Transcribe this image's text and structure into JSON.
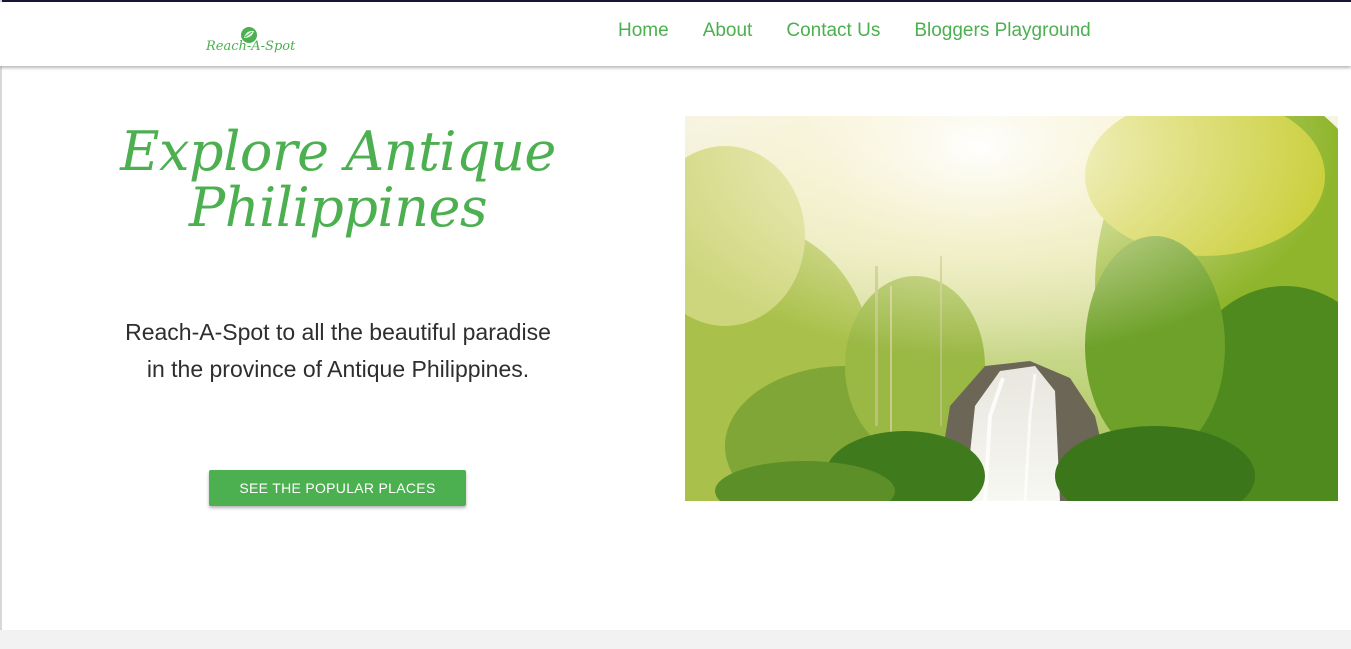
{
  "brand": {
    "logo_text": "Reach-A-Spot",
    "icon": "leaf-icon"
  },
  "nav": {
    "links": [
      {
        "label": "Home"
      },
      {
        "label": "About"
      },
      {
        "label": "Contact Us"
      },
      {
        "label": "Bloggers Playground"
      }
    ]
  },
  "hero": {
    "title_line1": "Explore Antique",
    "title_line2": "Philippines",
    "description": "Reach-A-Spot to all the beautiful paradise in the province of Antique Philippines.",
    "cta_label": "SEE THE POPULAR PLACES"
  },
  "colors": {
    "accent": "#4caf50",
    "top_border": "#16163a",
    "text": "#2e2e2e"
  }
}
